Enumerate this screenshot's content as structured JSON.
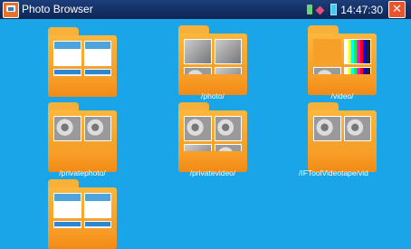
{
  "titlebar": {
    "title": "Photo Browser",
    "time": "14:47:30",
    "icons": [
      "sd-card-icon",
      "usb-icon",
      "battery-icon"
    ],
    "close_symbol": "✕"
  },
  "folders": [
    {
      "label": ""
    },
    {
      "label": "/photo/"
    },
    {
      "label": "/video/"
    },
    {
      "label": "/privatephoto/"
    },
    {
      "label": "/privatevideo/"
    },
    {
      "label": "/IFToolVideotape/vid"
    },
    {
      "label": ""
    }
  ]
}
